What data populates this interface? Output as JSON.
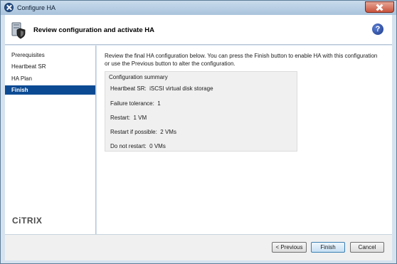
{
  "window": {
    "title": "Configure HA"
  },
  "header": {
    "title": "Review configuration and activate HA"
  },
  "sidebar": {
    "items": [
      {
        "label": "Prerequisites",
        "active": false
      },
      {
        "label": "Heartbeat SR",
        "active": false
      },
      {
        "label": "HA Plan",
        "active": false
      },
      {
        "label": "Finish",
        "active": true
      }
    ],
    "logo": "CiTRIX"
  },
  "content": {
    "intro": "Review the final HA configuration below. You can press the Finish button to enable HA with this configuration or use the Previous button to alter the configuration.",
    "summary": {
      "title": "Configuration summary",
      "rows": [
        {
          "label": "Heartbeat SR:",
          "value": "iSCSI virtual disk storage"
        },
        {
          "label": "Failure tolerance:",
          "value": "1"
        },
        {
          "label": "Restart:",
          "value": "1 VM"
        },
        {
          "label": "Restart if possible:",
          "value": "2 VMs"
        },
        {
          "label": "Do not restart:",
          "value": "0 VMs"
        }
      ]
    }
  },
  "footer": {
    "previous_label": "< Previous",
    "finish_label": "Finish",
    "cancel_label": "Cancel"
  }
}
